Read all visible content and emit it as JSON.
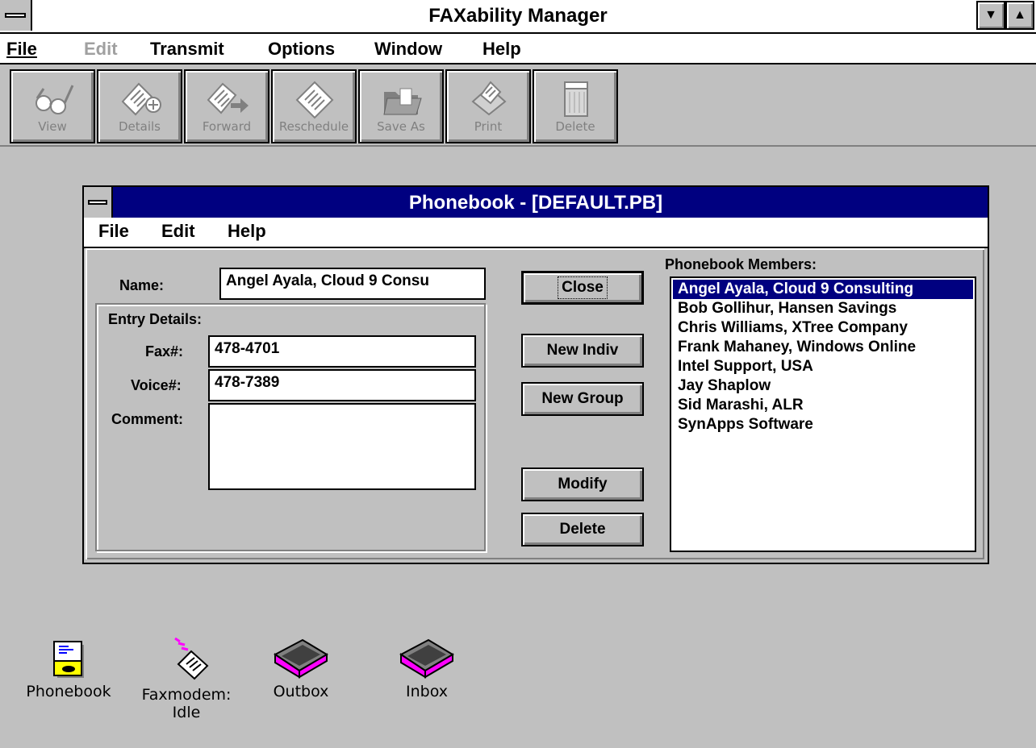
{
  "app": {
    "title": "FAXability Manager",
    "menu": [
      "File",
      "Edit",
      "Transmit",
      "Options",
      "Window",
      "Help"
    ]
  },
  "toolbar": [
    {
      "label": "View",
      "icon": "view-icon"
    },
    {
      "label": "Details",
      "icon": "details-icon"
    },
    {
      "label": "Forward",
      "icon": "forward-icon"
    },
    {
      "label": "Reschedule",
      "icon": "reschedule-icon"
    },
    {
      "label": "Save As",
      "icon": "save-as-icon"
    },
    {
      "label": "Print",
      "icon": "print-icon"
    },
    {
      "label": "Delete",
      "icon": "delete-icon"
    }
  ],
  "phonebook": {
    "title": "Phonebook - [DEFAULT.PB]",
    "menu": [
      "File",
      "Edit",
      "Help"
    ],
    "name_label": "Name:",
    "name_value": "Angel Ayala, Cloud 9 Consu",
    "entry_details_label": "Entry Details:",
    "fax_label": "Fax#:",
    "fax_value": "478-4701",
    "voice_label": "Voice#:",
    "voice_value": "478-7389",
    "comment_label": "Comment:",
    "comment_value": "",
    "buttons": {
      "close": "Close",
      "new_indiv": "New Indiv",
      "new_group": "New Group",
      "modify": "Modify",
      "delete": "Delete"
    },
    "members_label": "Phonebook Members:",
    "members": [
      "Angel Ayala, Cloud 9 Consulting",
      "Bob Gollihur, Hansen Savings",
      "Chris Williams, XTree Company",
      "Frank Mahaney, Windows Online",
      "Intel Support, USA",
      "Jay Shaplow",
      "Sid Marashi, ALR",
      "SynApps Software"
    ],
    "selected_member": "Angel Ayala, Cloud 9 Consulting"
  },
  "desktop_icons": [
    {
      "label": "Phonebook",
      "label2": "",
      "icon": "phonebook-icon"
    },
    {
      "label": "Faxmodem:",
      "label2": "Idle",
      "icon": "faxmodem-icon"
    },
    {
      "label": "Outbox",
      "label2": "",
      "icon": "outbox-icon"
    },
    {
      "label": "Inbox",
      "label2": "",
      "icon": "inbox-icon"
    }
  ],
  "colors": {
    "desktop": "#c0c0c0",
    "active_title": "#000080",
    "selection": "#000080",
    "disabled_text": "#808080",
    "tray_magenta": "#ff00ff"
  }
}
